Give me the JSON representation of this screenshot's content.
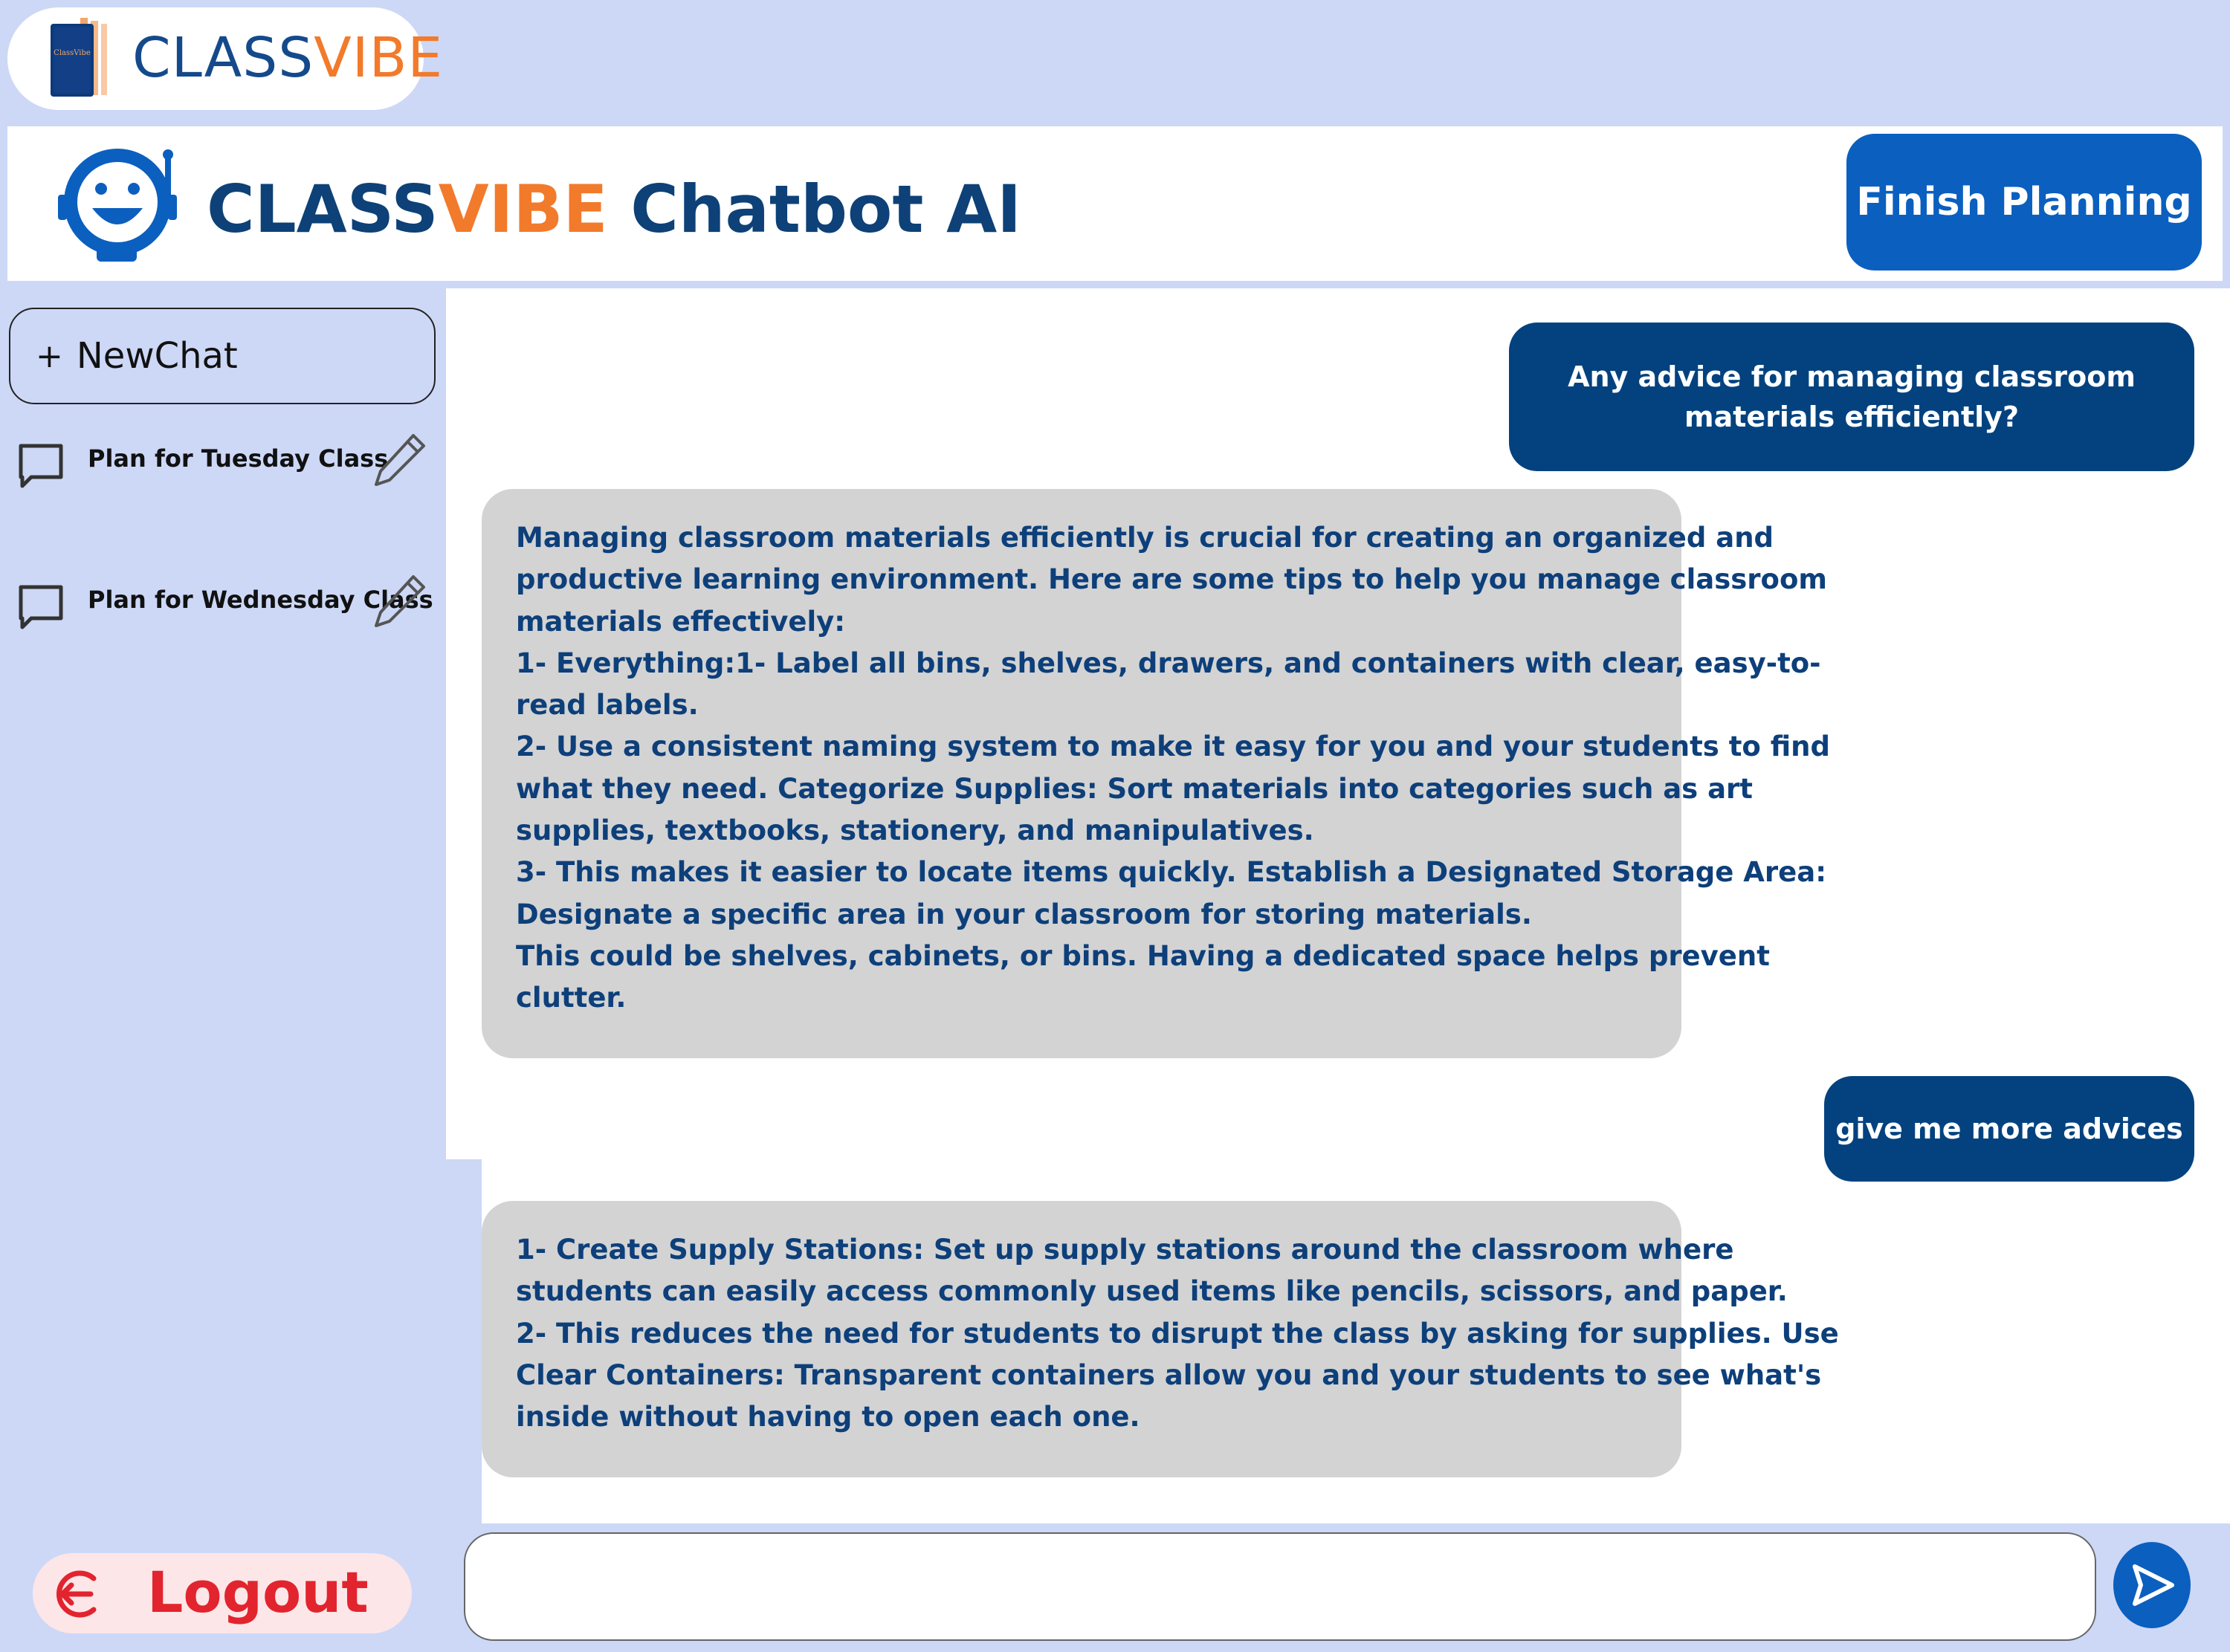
{
  "brand": {
    "logo_caption": "ClassVibe",
    "name_part1": "CLASS",
    "name_part2": "VIBE"
  },
  "header": {
    "title_part1": "CLASS",
    "title_part2": "VIBE",
    "title_part3": " Chatbot AI",
    "finish_button": "Finish Planning"
  },
  "sidebar": {
    "new_chat_plus": "+",
    "new_chat_label": "NewChat",
    "history": [
      {
        "label": "Plan for Tuesday Class"
      },
      {
        "label": "Plan for Wednesday Class"
      }
    ]
  },
  "chat": {
    "messages": [
      {
        "role": "user",
        "text": "Any advice for managing classroom materials efficiently?"
      },
      {
        "role": "bot",
        "lines": [
          "Managing classroom materials efficiently is crucial for creating an organized and",
          "productive learning environment. Here are some tips to help you manage classroom",
          "materials effectively:",
          "1- Everything:1- Label all bins, shelves, drawers, and containers with clear, easy-to-",
          "read labels.",
          "2- Use a consistent naming system to make it easy for you and your students to find",
          "what they need. Categorize Supplies: Sort materials into categories such as art",
          "supplies, textbooks, stationery, and manipulatives.",
          "3- This makes it easier to locate items quickly. Establish a Designated Storage Area:",
          "Designate a specific area in your classroom for storing materials.",
          "This could be shelves, cabinets, or bins. Having a dedicated space helps prevent",
          "clutter."
        ]
      },
      {
        "role": "user",
        "text": "give me more advices"
      },
      {
        "role": "bot",
        "lines": [
          "1- Create Supply Stations: Set up supply stations around the classroom where",
          "students can easily access commonly used items like pencils, scissors, and paper.",
          "2- This reduces the need for students to disrupt the class by asking for supplies. Use",
          "Clear Containers: Transparent containers allow you and your students to see what's",
          "inside without having to open each one."
        ]
      }
    ]
  },
  "footer": {
    "logout_label": "Logout",
    "input_value": "",
    "input_placeholder": ""
  },
  "colors": {
    "page_bg": "#cdd8f7",
    "brand_blue": "#144a8c",
    "brand_orange": "#f27a2b",
    "user_bubble": "#03427f",
    "bot_bubble": "#d3d3d3",
    "finish_button": "#0b5fbf",
    "logout_red": "#e2242e"
  },
  "icons": {
    "bot": "robot-face-icon",
    "chat": "chat-bubble-icon",
    "edit": "pencil-icon",
    "logout": "logout-icon",
    "send": "send-arrow-icon"
  }
}
